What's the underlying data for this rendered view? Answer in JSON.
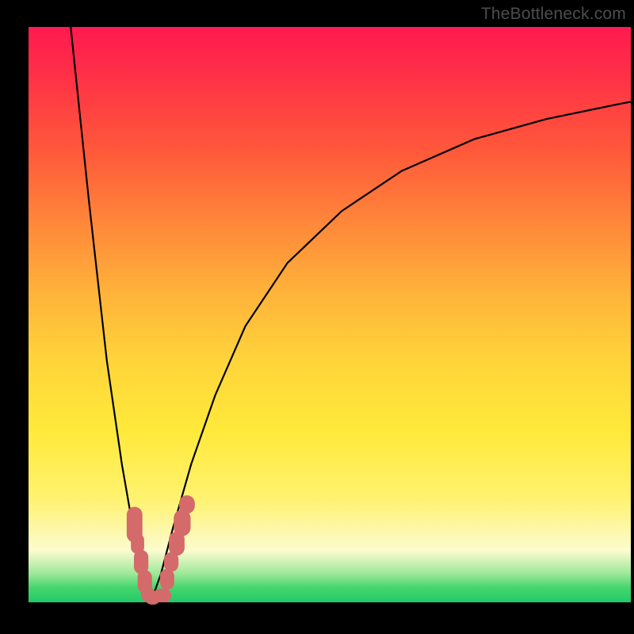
{
  "watermark": "TheBottleneck.com",
  "chart_data": {
    "type": "line",
    "title": "",
    "xlabel": "",
    "ylabel": "",
    "xlim": [
      0,
      100
    ],
    "ylim": [
      0,
      100
    ],
    "note": "Axes and ticks are not shown; values estimated from curve positions.",
    "series": [
      {
        "name": "left-descending-curve",
        "x": [
          7,
          10,
          13,
          15.5,
          17,
          18.2,
          19,
          19.7,
          20.3
        ],
        "y": [
          100,
          70,
          42,
          24,
          15,
          9,
          4.5,
          1.8,
          0
        ]
      },
      {
        "name": "right-ascending-curve",
        "x": [
          20.3,
          22,
          24,
          27,
          31,
          36,
          43,
          52,
          62,
          74,
          86,
          98,
          100
        ],
        "y": [
          0,
          5,
          13,
          24,
          36,
          48,
          59,
          68,
          75,
          80.5,
          84,
          86.6,
          87
        ]
      }
    ],
    "marker_clusters": [
      {
        "name": "left-branch-lozenges",
        "points": [
          {
            "x": 17.6,
            "y": 13.5,
            "w": 2.6,
            "h": 6.2
          },
          {
            "x": 18.1,
            "y": 10.2,
            "w": 2.2,
            "h": 3.6
          },
          {
            "x": 18.7,
            "y": 7.0,
            "w": 2.4,
            "h": 4.2
          },
          {
            "x": 19.3,
            "y": 3.6,
            "w": 2.4,
            "h": 4.0
          },
          {
            "x": 19.8,
            "y": 1.4,
            "w": 2.3,
            "h": 2.6
          }
        ]
      },
      {
        "name": "valley-lozenges",
        "points": [
          {
            "x": 20.6,
            "y": 0.8,
            "w": 2.6,
            "h": 2.4
          },
          {
            "x": 22.2,
            "y": 1.2,
            "w": 3.0,
            "h": 2.4
          }
        ]
      },
      {
        "name": "right-branch-lozenges",
        "points": [
          {
            "x": 23.0,
            "y": 4.0,
            "w": 2.4,
            "h": 3.6
          },
          {
            "x": 23.7,
            "y": 7.0,
            "w": 2.4,
            "h": 3.4
          },
          {
            "x": 24.6,
            "y": 10.2,
            "w": 2.6,
            "h": 4.2
          },
          {
            "x": 25.5,
            "y": 13.8,
            "w": 2.8,
            "h": 4.6
          },
          {
            "x": 26.3,
            "y": 17.0,
            "w": 2.6,
            "h": 3.2
          }
        ]
      }
    ],
    "gradient_stops": [
      {
        "pos": 0,
        "color": "#ff1a4f"
      },
      {
        "pos": 0.22,
        "color": "#ff5a3a"
      },
      {
        "pos": 0.46,
        "color": "#ffb23a"
      },
      {
        "pos": 0.7,
        "color": "#ffe93a"
      },
      {
        "pos": 0.91,
        "color": "#fcfccf"
      },
      {
        "pos": 1.0,
        "color": "#22c96a"
      }
    ]
  }
}
